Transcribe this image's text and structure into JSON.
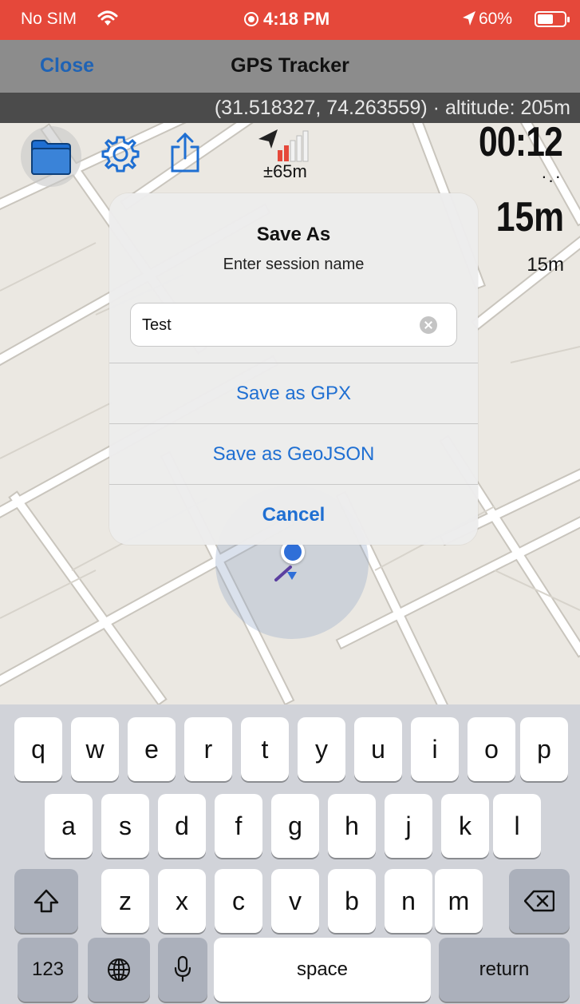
{
  "status_bar": {
    "carrier": "No SIM",
    "time": "4:18 PM",
    "battery": "60%",
    "battery_level": 0.6
  },
  "nav": {
    "close_label": "Close",
    "title": "GPS Tracker"
  },
  "location_banner": "(31.518327, 74.263559) · altitude: 205m",
  "toolbar": {
    "icons": [
      "folder-icon",
      "gear-icon",
      "share-icon",
      "signal-icon"
    ],
    "accuracy": "±65m"
  },
  "stats": {
    "elapsed": "00:12",
    "elapsed_sub": "·.·",
    "distance": "15m",
    "distance_sub": "15m"
  },
  "dialog": {
    "title": "Save As",
    "message": "Enter session name",
    "input_value": "Test",
    "actions": [
      "Save as GPX",
      "Save as GeoJSON",
      "Cancel"
    ]
  },
  "keyboard": {
    "row1": [
      "q",
      "w",
      "e",
      "r",
      "t",
      "y",
      "u",
      "i",
      "o",
      "p"
    ],
    "row2": [
      "a",
      "s",
      "d",
      "f",
      "g",
      "h",
      "j",
      "k",
      "l"
    ],
    "row3": [
      "z",
      "x",
      "c",
      "v",
      "b",
      "n",
      "m"
    ],
    "numbers_label": "123",
    "space_label": "space",
    "return_label": "return"
  },
  "colors": {
    "status_bar": "#e5483a",
    "accent": "#1f6fd2",
    "location_dot": "#2f6fd8"
  }
}
